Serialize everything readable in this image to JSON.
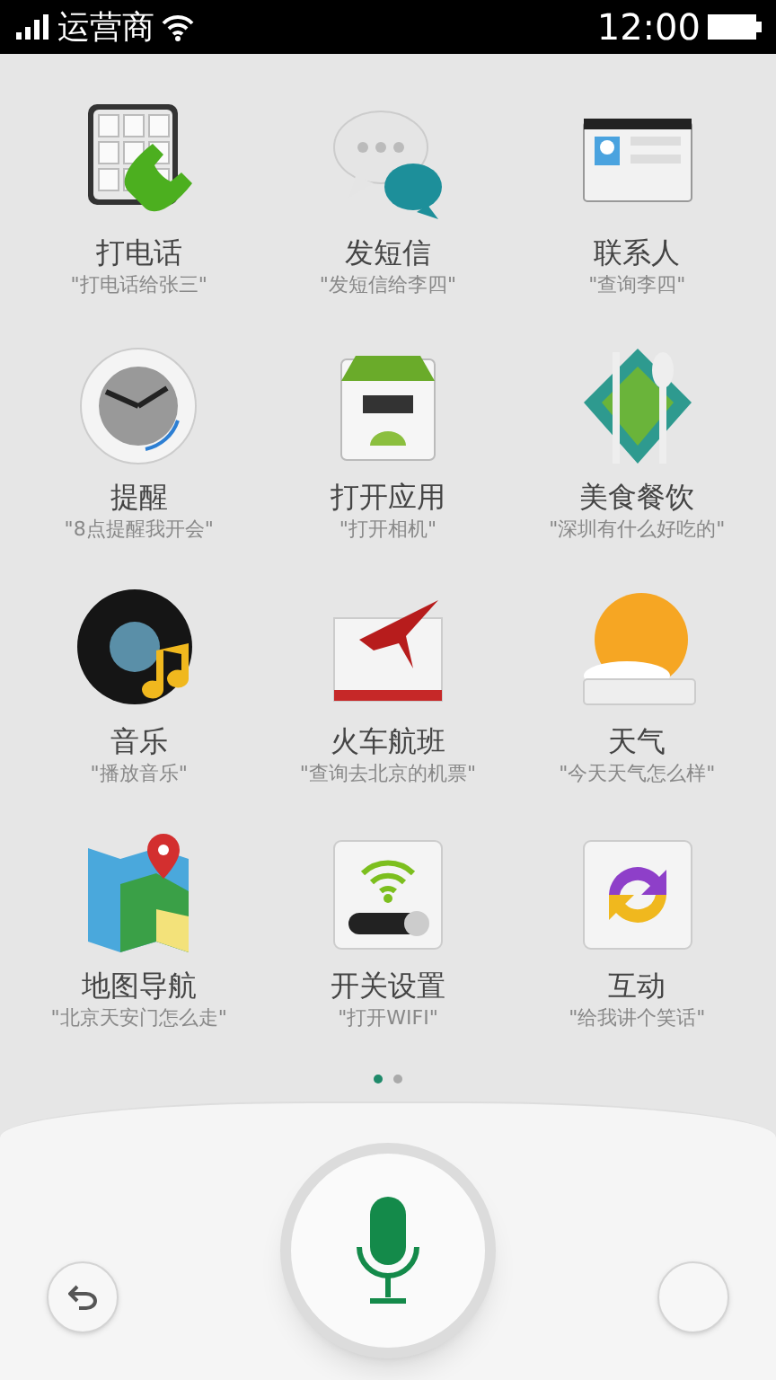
{
  "status_bar": {
    "carrier": "运营商",
    "time": "12:00"
  },
  "commands": [
    {
      "kind": "phone",
      "title": "打电话",
      "example": "\"打电话给张三\""
    },
    {
      "kind": "sms",
      "title": "发短信",
      "example": "\"发短信给李四\""
    },
    {
      "kind": "contacts",
      "title": "联系人",
      "example": "\"查询李四\""
    },
    {
      "kind": "clock",
      "title": "提醒",
      "example": "\"8点提醒我开会\""
    },
    {
      "kind": "app",
      "title": "打开应用",
      "example": "\"打开相机\""
    },
    {
      "kind": "food",
      "title": "美食餐饮",
      "example": "\"深圳有什么好吃的\""
    },
    {
      "kind": "music",
      "title": "音乐",
      "example": "\"播放音乐\""
    },
    {
      "kind": "flight",
      "title": "火车航班",
      "example": "\"查询去北京的机票\""
    },
    {
      "kind": "weather",
      "title": "天气",
      "example": "\"今天天气怎么样\""
    },
    {
      "kind": "map",
      "title": "地图导航",
      "example": "\"北京天安门怎么走\""
    },
    {
      "kind": "switch",
      "title": "开关设置",
      "example": "\"打开WIFI\""
    },
    {
      "kind": "chat",
      "title": "互动",
      "example": "\"给我讲个笑话\""
    }
  ],
  "pages": [
    {
      "selected": true
    },
    {
      "selected": false
    }
  ]
}
